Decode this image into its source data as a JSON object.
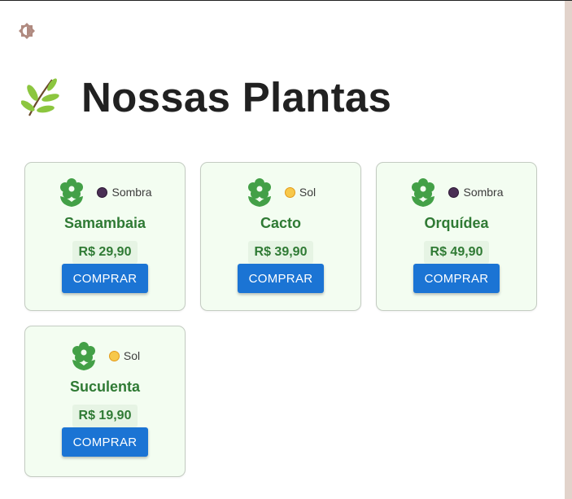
{
  "header": {
    "title": "Nossas Plantas",
    "icon": "herb-icon",
    "theme_toggle_icon": "brightness-icon"
  },
  "colors": {
    "accent_green": "#2f7a34",
    "button_blue": "#1b74d4",
    "card_background": "#f3fdf1"
  },
  "products": [
    {
      "name": "Samambaia",
      "light": "Sombra",
      "price": "R$ 29,90",
      "button_label": "COMPRAR"
    },
    {
      "name": "Cacto",
      "light": "Sol",
      "price": "R$ 39,90",
      "button_label": "COMPRAR"
    },
    {
      "name": "Orquídea",
      "light": "Sombra",
      "price": "R$ 49,90",
      "button_label": "COMPRAR"
    },
    {
      "name": "Suculenta",
      "light": "Sol",
      "price": "R$ 19,90",
      "button_label": "COMPRAR"
    }
  ]
}
